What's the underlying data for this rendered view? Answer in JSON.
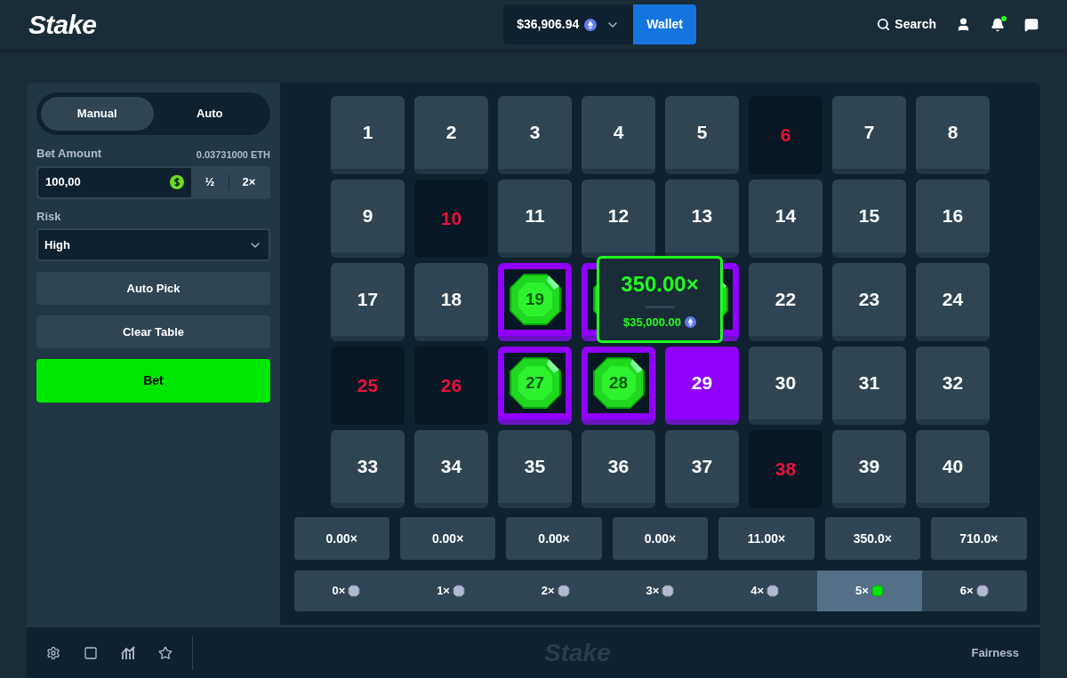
{
  "header": {
    "logo": "Stake",
    "balance": "$36,906.94",
    "wallet_button": "Wallet",
    "search": "Search",
    "notification_dot": true
  },
  "sidebar": {
    "modes": [
      {
        "label": "Manual",
        "selected": true
      },
      {
        "label": "Auto",
        "selected": false
      }
    ],
    "bet_amount": {
      "label": "Bet Amount",
      "conversion": "0.03731000 ETH",
      "value": "100,00",
      "half": "½",
      "double": "2×"
    },
    "risk": {
      "label": "Risk",
      "value": "High"
    },
    "buttons": [
      "Auto Pick",
      "Clear Table"
    ],
    "bet_button": "Bet"
  },
  "tiles": [
    {
      "kind": "plain",
      "label": "1"
    },
    {
      "kind": "plain",
      "label": "2"
    },
    {
      "kind": "plain",
      "label": "3"
    },
    {
      "kind": "plain",
      "label": "4"
    },
    {
      "kind": "plain",
      "label": "5"
    },
    {
      "kind": "miss",
      "label": "6"
    },
    {
      "kind": "plain",
      "label": "7"
    },
    {
      "kind": "plain",
      "label": "8"
    },
    {
      "kind": "plain",
      "label": "9"
    },
    {
      "kind": "miss",
      "label": "10"
    },
    {
      "kind": "plain",
      "label": "11"
    },
    {
      "kind": "plain",
      "label": "12"
    },
    {
      "kind": "plain",
      "label": "13"
    },
    {
      "kind": "plain",
      "label": "14"
    },
    {
      "kind": "plain",
      "label": "15"
    },
    {
      "kind": "plain",
      "label": "16"
    },
    {
      "kind": "plain",
      "label": "17"
    },
    {
      "kind": "plain",
      "label": "18"
    },
    {
      "kind": "gem",
      "label": "19"
    },
    {
      "kind": "gem"
    },
    {
      "kind": "gem"
    },
    {
      "kind": "plain",
      "label": "22"
    },
    {
      "kind": "plain",
      "label": "23"
    },
    {
      "kind": "plain",
      "label": "24"
    },
    {
      "kind": "miss",
      "label": "25"
    },
    {
      "kind": "miss",
      "label": "26"
    },
    {
      "kind": "gem",
      "label": "27"
    },
    {
      "kind": "gem",
      "label": "28"
    },
    {
      "kind": "picked",
      "label": "29"
    },
    {
      "kind": "plain",
      "label": "30"
    },
    {
      "kind": "plain",
      "label": "31"
    },
    {
      "kind": "plain",
      "label": "32"
    },
    {
      "kind": "plain",
      "label": "33"
    },
    {
      "kind": "plain",
      "label": "34"
    },
    {
      "kind": "plain",
      "label": "35"
    },
    {
      "kind": "plain",
      "label": "36"
    },
    {
      "kind": "plain",
      "label": "37"
    },
    {
      "kind": "miss",
      "label": "38"
    },
    {
      "kind": "plain",
      "label": "39"
    },
    {
      "kind": "plain",
      "label": "40"
    }
  ],
  "tooltip": {
    "multiplier": "350.00×",
    "payout": "$35,000.00"
  },
  "payouts": [
    "0.00×",
    "0.00×",
    "0.00×",
    "0.00×",
    "11.00×",
    "350.0×",
    "710.0×"
  ],
  "hits": [
    {
      "label": "0×",
      "selected": false
    },
    {
      "label": "1×",
      "selected": false
    },
    {
      "label": "2×",
      "selected": false
    },
    {
      "label": "3×",
      "selected": false
    },
    {
      "label": "4×",
      "selected": false
    },
    {
      "label": "5×",
      "selected": true
    },
    {
      "label": "6×",
      "selected": false
    }
  ],
  "footer": {
    "logo": "Stake",
    "fairness": "Fairness"
  }
}
